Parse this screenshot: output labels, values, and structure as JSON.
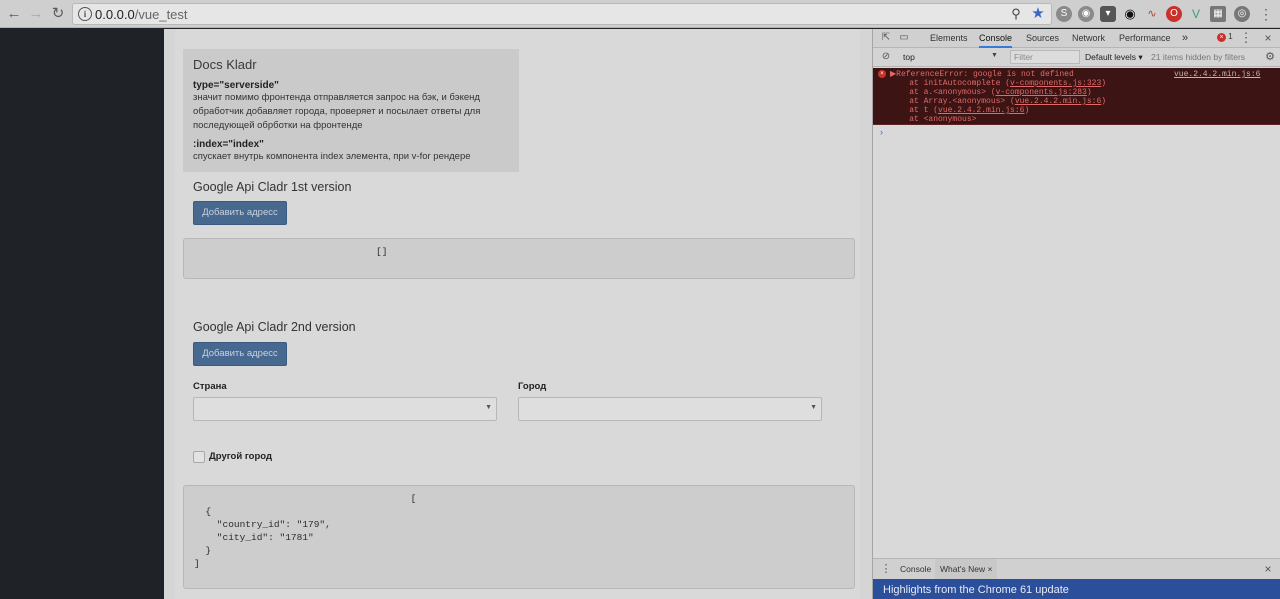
{
  "browser": {
    "url_host": "0.0.0.0",
    "url_path": "/vue_test",
    "back_icon": "arrow-left",
    "forward_icon": "arrow-right",
    "reload_icon": "reload"
  },
  "docs": {
    "title": "Docs Kladr",
    "attr1": "type=\"serverside\"",
    "desc1": "значит помимо фронтенда отправляется запрос на бэк, и бэкенд обработчик добавляет города, проверяет и посылает ответы для последующей обрботки на фронтенде",
    "attr2": ":index=\"index\"",
    "desc2": "спускает внутрь компонента index элемента, при v-for рендере"
  },
  "section1": {
    "title": "Google Api Cladr 1st version",
    "button": "Добавить адресс",
    "output": "[]"
  },
  "section2": {
    "title": "Google Api Cladr 2nd version",
    "button": "Добавить адресс",
    "country_label": "Страна",
    "country_value": "",
    "city_label": "Город",
    "city_value": "",
    "other_city_label": "Другой город",
    "output": "                                      [\n  {\n    \"country_id\": \"179\",\n    \"city_id\": \"1781\"\n  }\n]"
  },
  "devtools": {
    "tabs": [
      "Elements",
      "Console",
      "Sources",
      "Network",
      "Performance"
    ],
    "more": "»",
    "error_count": "1",
    "context": "top",
    "filter_placeholder": "Filter",
    "levels": "Default levels ▾",
    "hidden": "21 items hidden by filters",
    "error": {
      "message": "▶ReferenceError: google is not defined",
      "source": "vue.2.4.2.min.js:6",
      "stack": [
        {
          "prefix": "    at initAutocomplete (",
          "link": "v-components.js:323",
          "suffix": ")"
        },
        {
          "prefix": "    at a.<anonymous> (",
          "link": "v-components.js:283",
          "suffix": ")"
        },
        {
          "prefix": "    at Array.<anonymous> (",
          "link": "vue.2.4.2.min.js:6",
          "suffix": ")"
        },
        {
          "prefix": "    at t (",
          "link": "vue.2.4.2.min.js:6",
          "suffix": ")"
        },
        {
          "prefix": "    at <anonymous>",
          "link": "",
          "suffix": ""
        }
      ]
    },
    "prompt": "›",
    "drawer_tabs": [
      "Console",
      "What's New"
    ],
    "whats_new_close": "×",
    "whats_new_headline": "Highlights from the Chrome 61 update"
  },
  "colors": {
    "primary_button": "#47688f",
    "console_error_bg": "#3d1414",
    "whats_new_bg": "#2c4f9b"
  }
}
